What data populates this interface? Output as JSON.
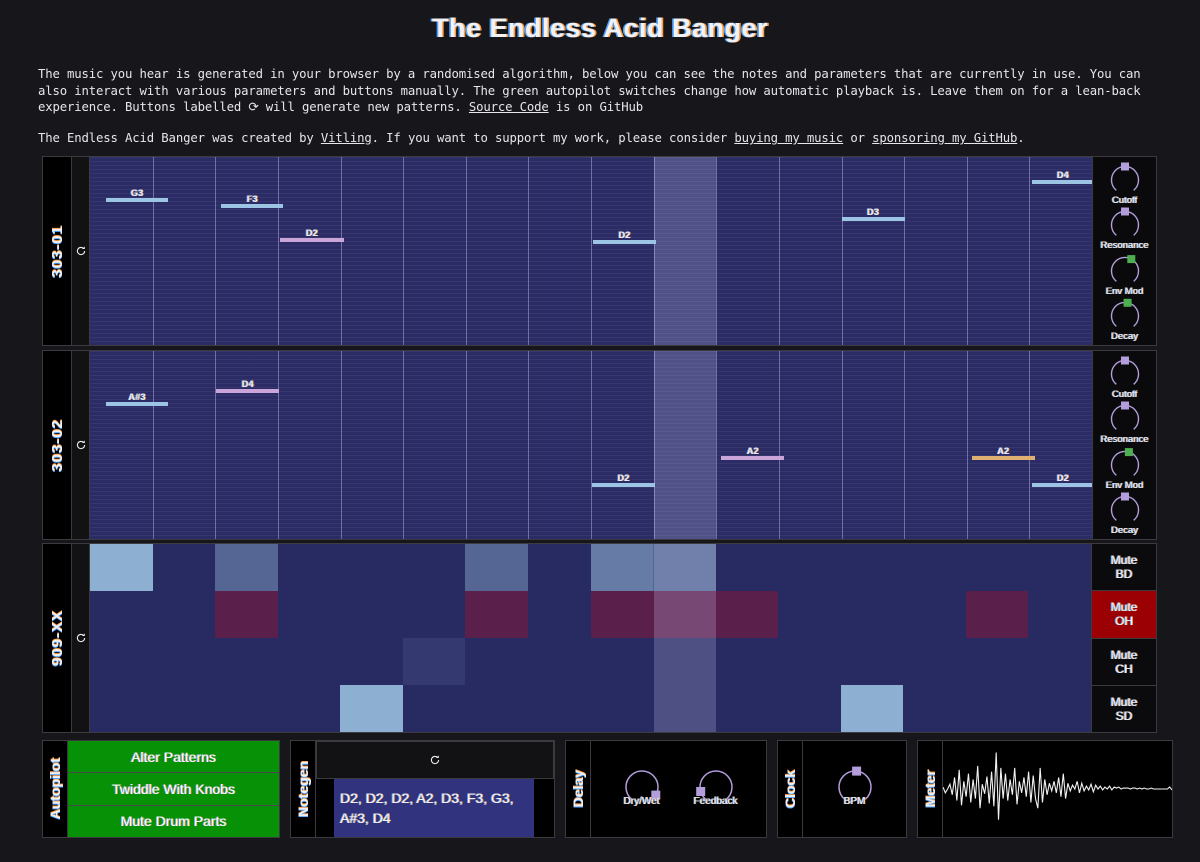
{
  "header": {
    "title": "The Endless Acid Banger",
    "intro_1a": "The music you hear is generated in your browser by a randomised algorithm, below you can see the notes and parameters that are currently in use. You can also interact with various parameters and buttons manually. The green autopilot switches change how automatic playback is. Leave them on for a lean-back experience. Buttons labelled ",
    "intro_1_refresh_glyph": "⟳",
    "intro_1b": " will generate new patterns. ",
    "intro_1_link": "Source Code",
    "intro_1c": " is on GitHub",
    "intro_2a": "The Endless Acid Banger was created by ",
    "intro_2_link_author": "Vitling",
    "intro_2b": ". If you want to support my work, please consider ",
    "intro_2_link_music": "buying my music",
    "intro_2c": " or ",
    "intro_2_link_sponsor": "sponsoring my GitHub",
    "intro_2d": "."
  },
  "colors": {
    "grid_bg": "#2b2b66",
    "note_blue": "#9cc4e4",
    "note_purple": "#cba4da",
    "note_orange": "#e0b072",
    "knob_purple": "#b39ddb",
    "knob_green": "#4caf50",
    "mute_active": "#9a0004",
    "autopilot_green": "#069106",
    "playhead": "#d7dcff"
  },
  "tracks": [
    {
      "name": "303-01",
      "randomize_icon": "refresh-icon",
      "notes": [
        {
          "label": "G3",
          "x": 1.6,
          "w": 6.2,
          "row": 22,
          "color": "#9cc4e4"
        },
        {
          "label": "F3",
          "x": 13.1,
          "w": 6.2,
          "row": 25,
          "color": "#9cc4e4"
        },
        {
          "label": "D2",
          "x": 19.0,
          "w": 6.3,
          "row": 43,
          "color": "#cba4da"
        },
        {
          "label": "D2",
          "x": 50.2,
          "w": 6.3,
          "row": 44,
          "color": "#9cc4e4"
        },
        {
          "label": "D3",
          "x": 75.0,
          "w": 6.3,
          "row": 32,
          "color": "#9cc4e4"
        },
        {
          "label": "D4",
          "x": 94.0,
          "w": 6.2,
          "row": 12,
          "color": "#9cc4e4"
        }
      ],
      "knobs": [
        {
          "label": "Cutoff",
          "value": 0.5,
          "color": "#b39ddb"
        },
        {
          "label": "Resonance",
          "value": 0.5,
          "color": "#b39ddb"
        },
        {
          "label": "Env Mod",
          "value": 0.6,
          "color": "#4caf50"
        },
        {
          "label": "Decay",
          "value": 0.54,
          "color": "#4caf50"
        }
      ]
    },
    {
      "name": "303-02",
      "randomize_icon": "refresh-icon",
      "notes": [
        {
          "label": "A#3",
          "x": 1.6,
          "w": 6.2,
          "row": 27,
          "color": "#9cc4e4"
        },
        {
          "label": "D4",
          "x": 12.6,
          "w": 6.3,
          "row": 20,
          "color": "#cba4da"
        },
        {
          "label": "D2",
          "x": 50.1,
          "w": 6.3,
          "row": 70,
          "color": "#9cc4e4"
        },
        {
          "label": "A2",
          "x": 63.0,
          "w": 6.3,
          "row": 56,
          "color": "#cba4da"
        },
        {
          "label": "A2",
          "x": 88.0,
          "w": 6.3,
          "row": 56,
          "color": "#e0b072"
        },
        {
          "label": "D2",
          "x": 94.0,
          "w": 6.2,
          "row": 70,
          "color": "#9cc4e4"
        }
      ],
      "knobs": [
        {
          "label": "Cutoff",
          "value": 0.5,
          "color": "#b39ddb"
        },
        {
          "label": "Resonance",
          "value": 0.5,
          "color": "#b39ddb"
        },
        {
          "label": "Env Mod",
          "value": 0.56,
          "color": "#4caf50"
        },
        {
          "label": "Decay",
          "value": 0.5,
          "color": "#b39ddb"
        }
      ]
    }
  ],
  "drum_machine": {
    "name": "909-XX",
    "randomize_icon": "refresh-icon",
    "rows": [
      {
        "name": "BD",
        "mute_label_top": "Mute",
        "mute_label_bottom": "BD",
        "muted": false,
        "steps": [
          1,
          0,
          0.45,
          0,
          0,
          0,
          0.45,
          0,
          0.62,
          0.45,
          0,
          0,
          0,
          0,
          0,
          0
        ]
      },
      {
        "name": "OH",
        "mute_label_top": "Mute",
        "mute_label_bottom": "OH",
        "muted": true,
        "steps": [
          0,
          0,
          0.6,
          0,
          0,
          0,
          0.6,
          0,
          0.6,
          0.6,
          0.6,
          0,
          0,
          0,
          0.6,
          0
        ]
      },
      {
        "name": "CH",
        "mute_label_top": "Mute",
        "mute_label_bottom": "CH",
        "muted": false,
        "steps": [
          0,
          0,
          0,
          0,
          0,
          0.12,
          0,
          0,
          0,
          0,
          0,
          0,
          0,
          0,
          0,
          0
        ]
      },
      {
        "name": "SD",
        "mute_label_top": "Mute",
        "mute_label_bottom": "SD",
        "muted": false,
        "steps": [
          0,
          0,
          0,
          0,
          1,
          0,
          0,
          0,
          0,
          0,
          0,
          0,
          1,
          0,
          0,
          0
        ]
      }
    ]
  },
  "playhead": {
    "start_pct": 56.3,
    "width_pct": 6.2
  },
  "bottom_panels": {
    "autopilot": {
      "label": "Autopilot",
      "buttons": [
        {
          "label": "Alter Patterns",
          "active": true
        },
        {
          "label": "Twiddle With Knobs",
          "active": true
        },
        {
          "label": "Mute Drum Parts",
          "active": true
        }
      ]
    },
    "notegen": {
      "label": "Notegen",
      "randomize_icon": "refresh-icon",
      "notes": "D2, D2, D2, A2, D3, F3, G3, A#3, D4"
    },
    "delay": {
      "label": "Delay",
      "knobs": [
        {
          "label": "Dry/Wet",
          "value": 0.93,
          "color": "#b39ddb"
        },
        {
          "label": "Feedback",
          "value": 0.12,
          "color": "#b39ddb"
        }
      ]
    },
    "clock": {
      "label": "Clock",
      "knobs": [
        {
          "label": "BPM",
          "value": 0.52,
          "color": "#b39ddb"
        }
      ]
    },
    "meter": {
      "label": "Meter",
      "waveform": [
        0.52,
        0.46,
        0.5,
        0.55,
        0.44,
        0.62,
        0.38,
        0.7,
        0.33,
        0.58,
        0.42,
        0.66,
        0.36,
        0.6,
        0.4,
        0.74,
        0.3,
        0.55,
        0.45,
        0.63,
        0.35,
        0.68,
        0.32,
        0.88,
        0.18,
        0.72,
        0.4,
        0.66,
        0.38,
        0.6,
        0.44,
        0.72,
        0.34,
        0.58,
        0.46,
        0.62,
        0.42,
        0.68,
        0.36,
        0.64,
        0.4,
        0.3,
        0.72,
        0.36,
        0.6,
        0.44,
        0.56,
        0.48,
        0.58,
        0.46,
        0.62,
        0.42,
        0.66,
        0.4,
        0.56,
        0.48,
        0.54,
        0.5,
        0.58,
        0.46,
        0.56,
        0.48,
        0.53,
        0.49,
        0.55,
        0.47,
        0.54,
        0.5,
        0.53,
        0.49,
        0.52,
        0.5,
        0.53,
        0.49,
        0.52,
        0.51,
        0.52,
        0.5,
        0.51,
        0.51,
        0.51,
        0.5,
        0.51,
        0.51,
        0.5,
        0.51,
        0.5,
        0.51,
        0.5,
        0.5,
        0.51,
        0.5,
        0.5,
        0.5,
        0.5,
        0.5,
        0.5,
        0.5,
        0.52,
        0.49
      ]
    }
  }
}
